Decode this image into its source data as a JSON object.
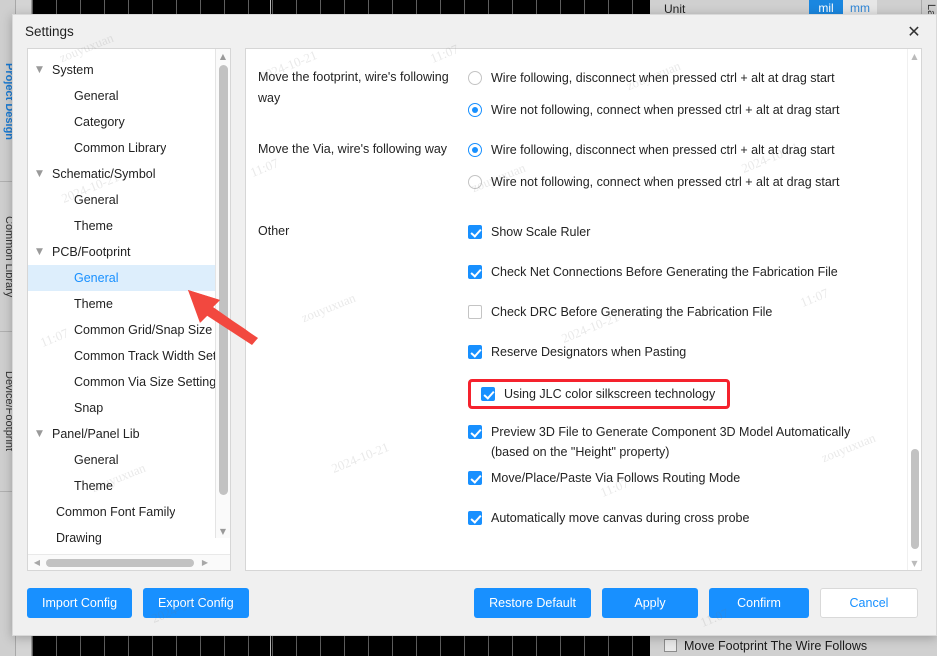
{
  "background": {
    "left_tabs": [
      {
        "label": "Project Design",
        "active": true
      },
      {
        "label": "Common Library",
        "active": false
      },
      {
        "label": "Device/Footprint",
        "active": false
      }
    ],
    "right_tab": "Layer",
    "unit_row": {
      "label": "Unit",
      "options": [
        "mil",
        "mm"
      ],
      "selected": "mil"
    },
    "bottom_row": {
      "label": "Move Footprint The Wire Follows",
      "checked": false
    }
  },
  "dialog": {
    "title": "Settings",
    "close_icon": "close-icon"
  },
  "sidebar": {
    "items": [
      {
        "label": "System",
        "level": "group",
        "caret": "▼",
        "selected": false
      },
      {
        "label": "General",
        "level": "child",
        "caret": "",
        "selected": false
      },
      {
        "label": "Category",
        "level": "child",
        "caret": "",
        "selected": false
      },
      {
        "label": "Common Library",
        "level": "child",
        "caret": "",
        "selected": false
      },
      {
        "label": "Schematic/Symbol",
        "level": "group",
        "caret": "▼",
        "selected": false
      },
      {
        "label": "General",
        "level": "child",
        "caret": "",
        "selected": false
      },
      {
        "label": "Theme",
        "level": "child",
        "caret": "",
        "selected": false
      },
      {
        "label": "PCB/Footprint",
        "level": "group",
        "caret": "▼",
        "selected": false
      },
      {
        "label": "General",
        "level": "child",
        "caret": "",
        "selected": true
      },
      {
        "label": "Theme",
        "level": "child",
        "caret": "",
        "selected": false
      },
      {
        "label": "Common Grid/Snap Size Se",
        "level": "child",
        "caret": "",
        "selected": false
      },
      {
        "label": "Common Track Width Settin",
        "level": "child",
        "caret": "",
        "selected": false
      },
      {
        "label": "Common Via Size Setting",
        "level": "child",
        "caret": "",
        "selected": false
      },
      {
        "label": "Snap",
        "level": "child",
        "caret": "",
        "selected": false
      },
      {
        "label": "Panel/Panel Lib",
        "level": "group",
        "caret": "▼",
        "selected": false
      },
      {
        "label": "General",
        "level": "child",
        "caret": "",
        "selected": false
      },
      {
        "label": "Theme",
        "level": "child",
        "caret": "",
        "selected": false
      },
      {
        "label": "Common Font Family",
        "level": "child-l1",
        "caret": "",
        "selected": false
      },
      {
        "label": "Drawing",
        "level": "child-l1",
        "caret": "",
        "selected": false
      }
    ]
  },
  "settings": {
    "groups": [
      {
        "label": "Move the footprint, wire's following way",
        "type": "radio",
        "options": [
          {
            "label": "Wire following, disconnect when pressed ctrl + alt at drag start",
            "checked": false
          },
          {
            "label": "Wire not following, connect when pressed ctrl + alt at drag start",
            "checked": true
          }
        ]
      },
      {
        "label": "Move the Via, wire's following way",
        "type": "radio",
        "options": [
          {
            "label": "Wire following, disconnect when pressed ctrl + alt at drag start",
            "checked": true
          },
          {
            "label": "Wire not following, connect when pressed ctrl + alt at drag start",
            "checked": false
          }
        ]
      }
    ],
    "other": {
      "label": "Other",
      "checkboxes": [
        {
          "label": "Show Scale Ruler",
          "checked": true,
          "highlighted": false
        },
        {
          "label": "Check Net Connections Before Generating the Fabrication File",
          "checked": true,
          "highlighted": false
        },
        {
          "label": "Check DRC Before Generating the Fabrication File",
          "checked": false,
          "highlighted": false
        },
        {
          "label": "Reserve Designators when Pasting",
          "checked": true,
          "highlighted": false
        },
        {
          "label": "Using JLC color silkscreen technology",
          "checked": true,
          "highlighted": true
        },
        {
          "label": "Preview 3D File to Generate Component 3D Model Automatically (based on the \"Height\" property)",
          "checked": true,
          "highlighted": false
        },
        {
          "label": "Move/Place/Paste Via Follows Routing Mode",
          "checked": true,
          "highlighted": false
        },
        {
          "label": "Automatically move canvas during cross probe",
          "checked": true,
          "highlighted": false
        }
      ]
    }
  },
  "footer": {
    "left_buttons": [
      {
        "label": "Import Config",
        "style": "primary"
      },
      {
        "label": "Export Config",
        "style": "primary"
      }
    ],
    "right_buttons": [
      {
        "label": "Restore Default",
        "style": "primary"
      },
      {
        "label": "Apply",
        "style": "primary"
      },
      {
        "label": "Confirm",
        "style": "primary"
      },
      {
        "label": "Cancel",
        "style": "ghost"
      }
    ]
  },
  "annotation": {
    "arrow_color": "#f2483f",
    "highlight_box_color": "#f5222d",
    "arrow_target": "sidebar-item-pcb-general"
  },
  "colors": {
    "accent": "#1890ff",
    "selected_row_bg": "#ddeefc",
    "dialog_bg": "#f0f0f0",
    "annotation_red": "#f5222d"
  },
  "watermarks": [
    "zouyuxuan",
    "2024-10-21",
    "11:07",
    "zouyuxuan",
    "2024-10-21",
    "11:07",
    "zouyuxuan",
    "2024-10-21",
    "11:07",
    "zouyuxuan",
    "2024-10-21",
    "11:07",
    "zouyuxuan",
    "2024-10-21",
    "11:07",
    "zouyuxuan",
    "2024-10-21",
    "11:07"
  ]
}
